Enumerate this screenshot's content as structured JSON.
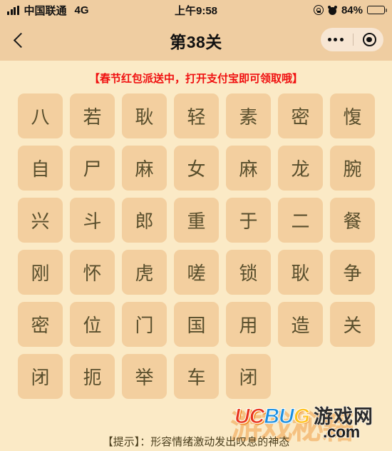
{
  "statusbar": {
    "carrier": "中国联通",
    "network": "4G",
    "time": "上午9:58",
    "battery_text": "84%",
    "battery_level": 84,
    "icons": [
      "signal-bars-icon",
      "rotation-lock-icon",
      "alarm-clock-icon",
      "battery-icon"
    ]
  },
  "navbar": {
    "back_icon": "chevron-left-icon",
    "title": "第38关",
    "capsule": {
      "menu_icon": "more-dots-icon",
      "close_icon": "target-circle-icon"
    }
  },
  "promo": {
    "text": "【春节红包派送中，打开支付宝即可领取哦】",
    "color": "#f01010"
  },
  "grid": {
    "columns": 7,
    "tile_color": "#f3cf9f",
    "text_color": "#584e2c",
    "rows": [
      [
        "八",
        "若",
        "耿",
        "轻",
        "素",
        "密",
        "愎"
      ],
      [
        "自",
        "尸",
        "麻",
        "女",
        "麻",
        "龙",
        "腕"
      ],
      [
        "兴",
        "斗",
        "郎",
        "重",
        "于",
        "二",
        "餐"
      ],
      [
        "刚",
        "怀",
        "虎",
        "嗟",
        "锁",
        "耿",
        "争"
      ],
      [
        "密",
        "位",
        "门",
        "国",
        "用",
        "造",
        "关"
      ],
      [
        "闭",
        "扼",
        "举",
        "车",
        "闭"
      ]
    ]
  },
  "hint": {
    "text": "【提示】：形容情绪激动发出叹息的神态"
  },
  "watermark": {
    "ghost": "游戏秘籍",
    "uc": "UC",
    "bu": "BU",
    "g": "G",
    "cn": "游戏网",
    "com": ".com"
  },
  "theme": {
    "header_bg": "#efcda1",
    "page_bg": "#fbeac6",
    "tile_bg": "#f3cf9f",
    "accent_red": "#f01010"
  }
}
